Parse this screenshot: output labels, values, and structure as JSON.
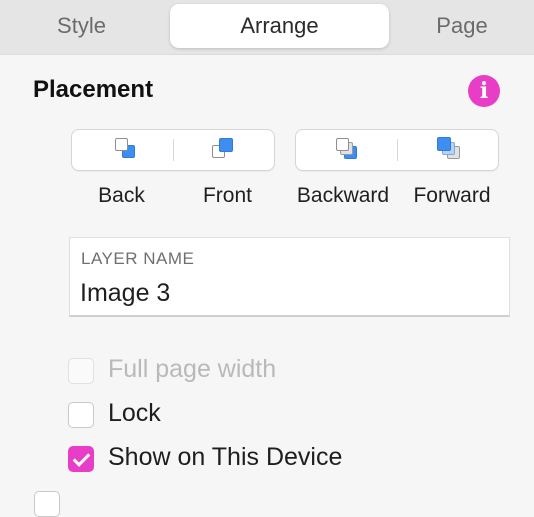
{
  "tabs": [
    {
      "label": "Style",
      "active": false
    },
    {
      "label": "Arrange",
      "active": true
    },
    {
      "label": "Page",
      "active": false
    }
  ],
  "placement": {
    "title": "Placement",
    "info_icon": "info-icon",
    "buttons": [
      {
        "label": "Back",
        "icon": "send-to-back-icon"
      },
      {
        "label": "Front",
        "icon": "bring-to-front-icon"
      },
      {
        "label": "Backward",
        "icon": "send-backward-icon"
      },
      {
        "label": "Forward",
        "icon": "bring-forward-icon"
      }
    ]
  },
  "layer_name": {
    "caption": "LAYER NAME",
    "value": "Image 3"
  },
  "options": [
    {
      "label": "Full page width",
      "checked": false,
      "disabled": true
    },
    {
      "label": "Lock",
      "checked": false,
      "disabled": false
    },
    {
      "label": "Show on This Device",
      "checked": true,
      "disabled": false
    }
  ],
  "colors": {
    "accent": "#e83ec7",
    "icon_blue": "#3d8ef0"
  }
}
